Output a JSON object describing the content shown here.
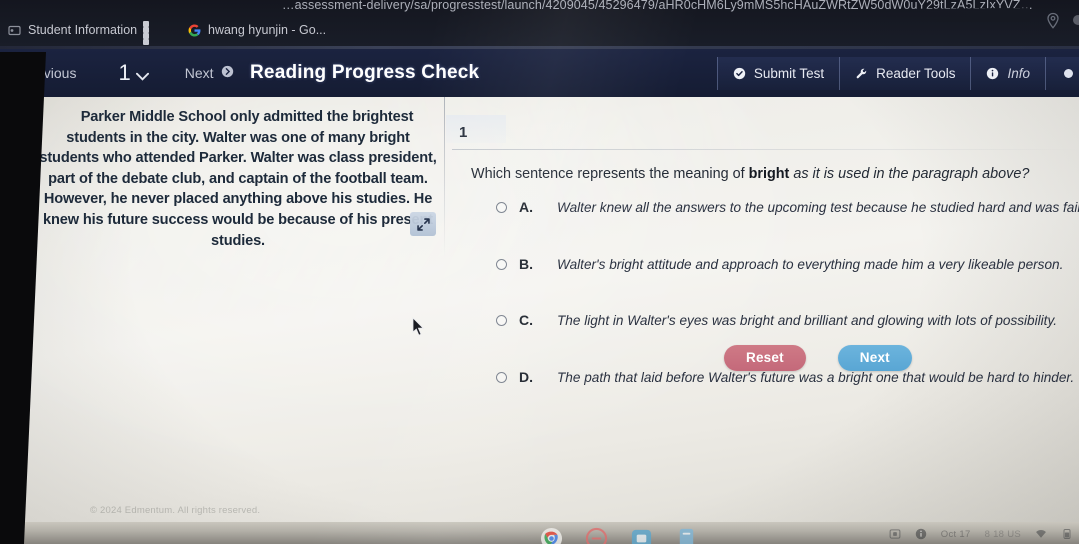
{
  "browser": {
    "url": "…assessment-delivery/sa/progresstest/launch/4209045/45296479/aHR0cHM6Ly9mMS5hcHAuZWRtZW50dW0uY29tLzA5LzIxYVZ…",
    "location_icon": "location-pin-icon",
    "bookmarks": [
      {
        "label": "Student Information",
        "icon": "site-favicon"
      },
      {
        "label": "",
        "icon": "apps-grid-icon"
      },
      {
        "label": "hwang hyunjin - Go...",
        "icon": "google-icon"
      }
    ]
  },
  "toolbar": {
    "previous_label": "Previous",
    "previous_icon": "arrow-left-circle-icon",
    "page_number": "1",
    "page_caret_icon": "chevron-down-icon",
    "next_label": "Next",
    "next_icon": "arrow-right-circle-icon",
    "title": "Reading Progress Check",
    "right_buttons": [
      {
        "label": "Submit Test",
        "icon": "check-circle-icon"
      },
      {
        "label": "Reader Tools",
        "icon": "wrench-icon"
      },
      {
        "label": "Info",
        "icon": "info-circle-icon"
      }
    ]
  },
  "passage": {
    "text": "Parker Middle School only admitted the brightest students in the city. Walter was one of many bright students who attended Parker. Walter was class president, part of the debate club, and captain of the football team. However, he never placed anything above his studies. He knew his future success would be because of his present studies.",
    "expand_icon": "expand-arrows-icon"
  },
  "question": {
    "number": "1",
    "stem_before": "Which sentence represents the meaning of ",
    "stem_keyword": "bright",
    "stem_after": " as it is used in the paragraph above?",
    "options": [
      {
        "letter": "A.",
        "text": "Walter knew all the answers to the upcoming test because he studied hard and was fairly bright."
      },
      {
        "letter": "B.",
        "text": "Walter's bright attitude and approach to everything made him a very likeable person."
      },
      {
        "letter": "C.",
        "text": "The light in Walter's eyes was bright and brilliant and glowing with lots of possibility."
      },
      {
        "letter": "D.",
        "text": "The path that laid before Walter's future was a bright one that would be hard to hinder."
      }
    ],
    "selected": null
  },
  "actions": {
    "reset_label": "Reset",
    "next_label": "Next"
  },
  "footer": {
    "copyright": "© 2024 Edmentum. All rights reserved."
  },
  "taskbar": {
    "clock": "Oct 17",
    "battery": "8 18 US",
    "tray_icons": [
      "screenshot-icon",
      "info-circle-icon",
      "wifi-icon",
      "battery-icon"
    ],
    "dock_apps": [
      "chrome-icon",
      "assistant-icon",
      "photos-icon",
      "files-icon"
    ]
  },
  "colors": {
    "toolbar_navy": "#1b2340",
    "page_bg": "#efeee9",
    "reset_red": "#c4697a",
    "next_blue": "#59a6d4",
    "text_dark": "#242b36"
  }
}
